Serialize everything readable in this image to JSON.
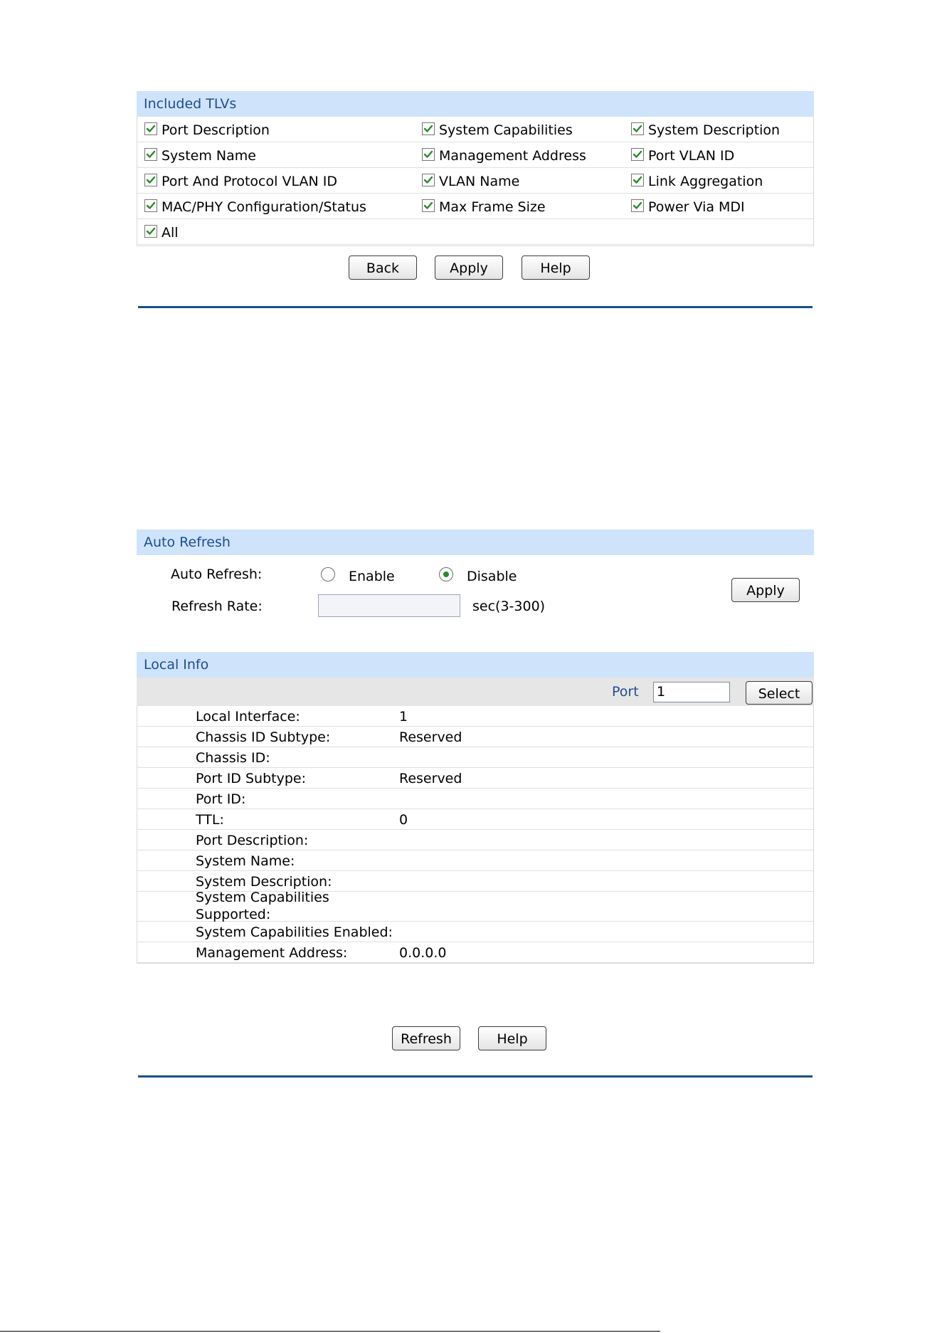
{
  "tlv": {
    "header": "Included TLVs",
    "rows": [
      [
        {
          "label": "Port Description",
          "checked": true
        },
        {
          "label": "System Capabilities",
          "checked": true
        },
        {
          "label": "System Description",
          "checked": true
        }
      ],
      [
        {
          "label": "System Name",
          "checked": true
        },
        {
          "label": "Management Address",
          "checked": true
        },
        {
          "label": "Port VLAN ID",
          "checked": true
        }
      ],
      [
        {
          "label": "Port And Protocol VLAN ID",
          "checked": true
        },
        {
          "label": "VLAN Name",
          "checked": true
        },
        {
          "label": "Link Aggregation",
          "checked": true
        }
      ],
      [
        {
          "label": "MAC/PHY Configuration/Status",
          "checked": true
        },
        {
          "label": "Max Frame Size",
          "checked": true
        },
        {
          "label": "Power Via MDI",
          "checked": true
        }
      ],
      [
        {
          "label": "All",
          "checked": true
        }
      ]
    ],
    "buttons": {
      "back": "Back",
      "apply": "Apply",
      "help": "Help"
    }
  },
  "auto_refresh": {
    "header": "Auto Refresh",
    "auto_refresh_label": "Auto Refresh:",
    "enable_label": "Enable",
    "disable_label": "Disable",
    "selected": "Disable",
    "refresh_rate_label": "Refresh Rate:",
    "refresh_rate_value": "",
    "rate_hint": "sec(3-300)",
    "apply_label": "Apply"
  },
  "local_info": {
    "header": "Local Info",
    "port_label": "Port",
    "port_value": "1",
    "select_label": "Select",
    "rows": [
      {
        "key": "Local Interface:",
        "value": "1"
      },
      {
        "key": "Chassis ID Subtype:",
        "value": "Reserved"
      },
      {
        "key": "Chassis ID:",
        "value": ""
      },
      {
        "key": "Port ID Subtype:",
        "value": "Reserved"
      },
      {
        "key": "Port ID:",
        "value": ""
      },
      {
        "key": "TTL:",
        "value": "0"
      },
      {
        "key": "Port Description:",
        "value": ""
      },
      {
        "key": "System Name:",
        "value": ""
      },
      {
        "key": "System Description:",
        "value": ""
      },
      {
        "key": "System Capabilities Supported:",
        "value": ""
      },
      {
        "key": "System Capabilities Enabled:",
        "value": ""
      },
      {
        "key": "Management Address:",
        "value": "0.0.0.0"
      }
    ],
    "buttons": {
      "refresh": "Refresh",
      "help": "Help"
    }
  },
  "colors": {
    "header_bg": "#cfe3fb",
    "header_text": "#1f4d8f",
    "rule": "#1b4f87",
    "check": "#2a8a2a"
  }
}
